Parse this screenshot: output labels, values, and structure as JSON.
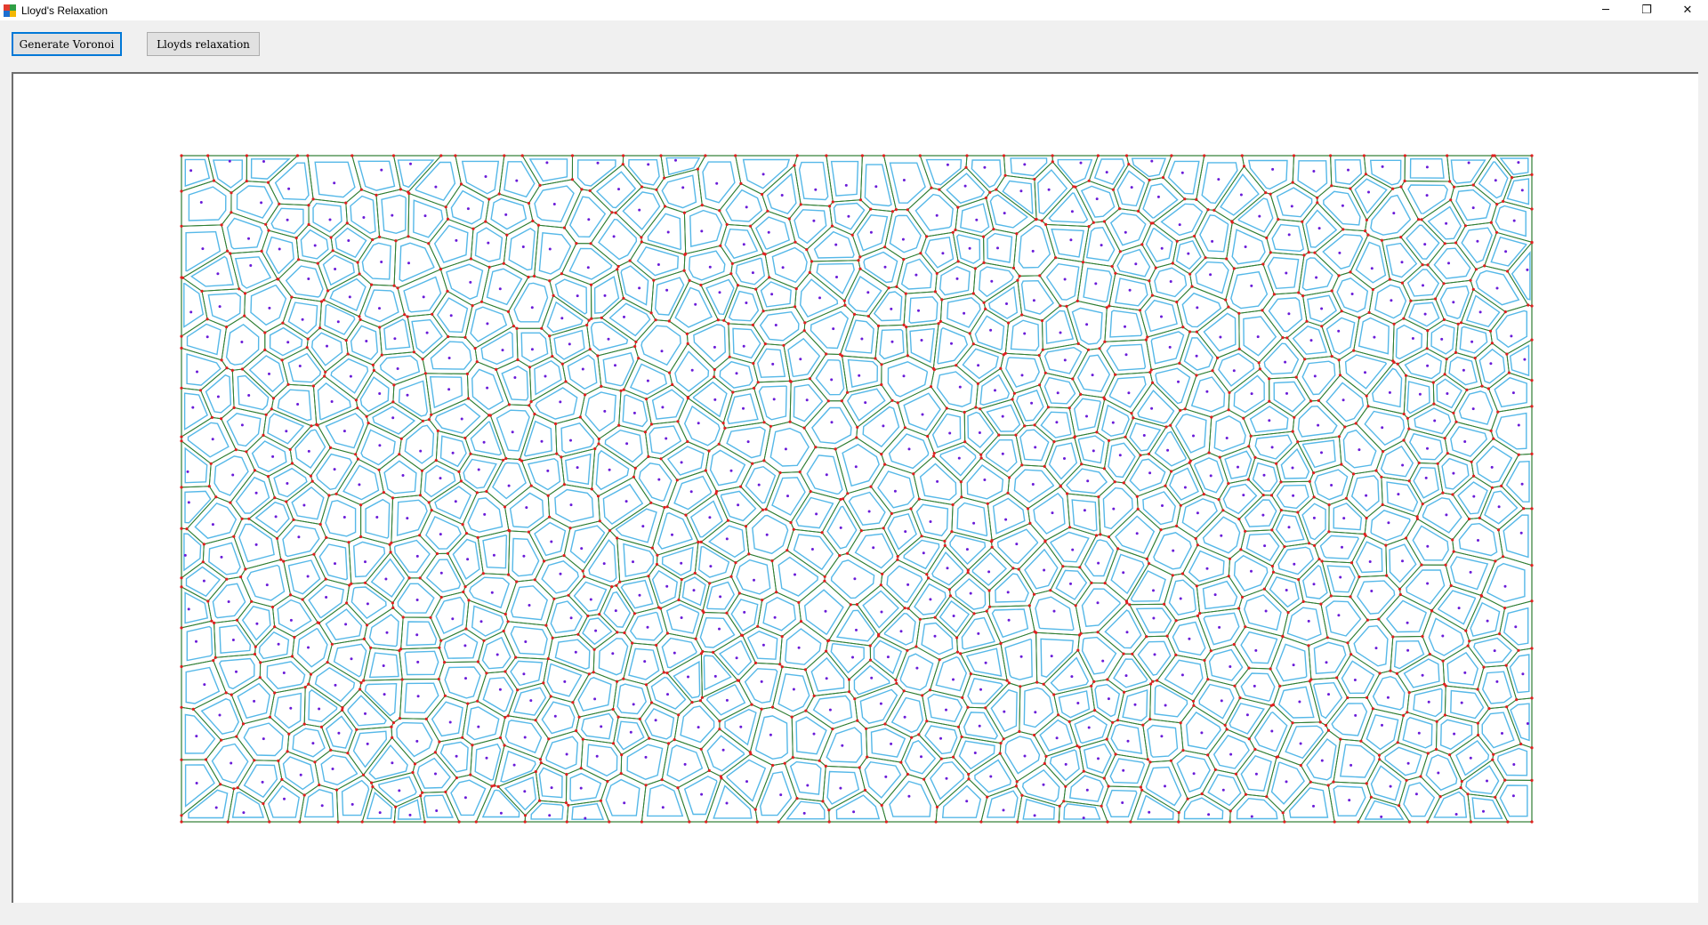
{
  "window": {
    "title": "Lloyd's Relaxation",
    "controls": {
      "minimize": "─",
      "restore": "❐",
      "close": "✕"
    }
  },
  "toolbar": {
    "generate_label": "Generate Voronoi",
    "relax_label": "Lloyds relaxation"
  },
  "diagram": {
    "colors": {
      "cell_edge": "#2e7d32",
      "vertex": "#e02020",
      "site": "#6a1bd8",
      "relaxed_cell": "#55b8e8",
      "panel_bg": "#ffffff"
    },
    "icons": [
      "voronoi-cell",
      "voronoi-vertex",
      "site-point",
      "centroid-polygon"
    ]
  }
}
